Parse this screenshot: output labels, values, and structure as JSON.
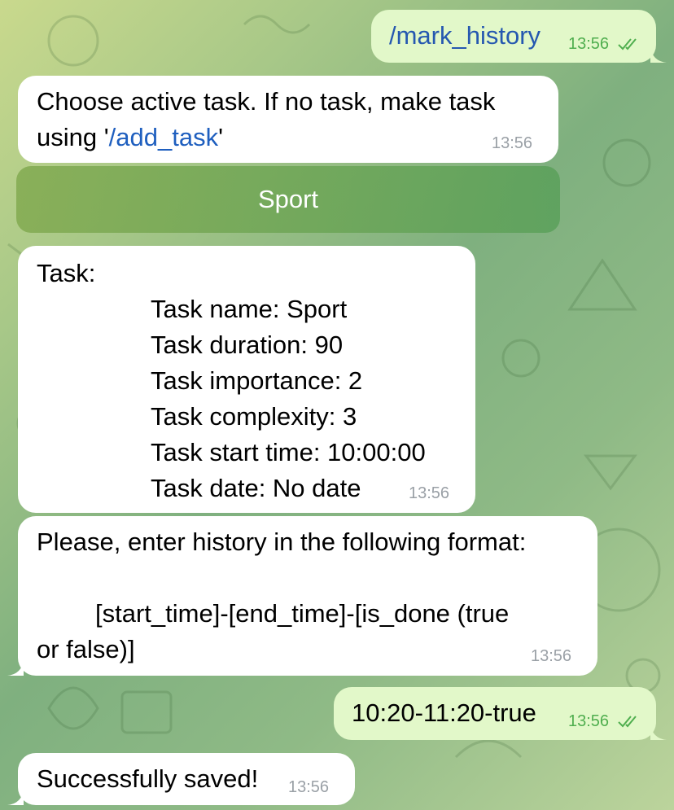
{
  "messages": {
    "cmd_mark_history": {
      "text": "/mark_history",
      "time": "13:56"
    },
    "choose_task": {
      "line1": "Choose active task. If no task, make task",
      "line2_pre": "using '",
      "line2_link": "/add_task",
      "line2_post": "'",
      "time": "13:56"
    },
    "keyboard": {
      "sport_button": "Sport"
    },
    "task_info": {
      "header": "Task:",
      "lines": [
        "Task name: Sport",
        "Task duration: 90",
        "Task importance: 2",
        "Task complexity: 3",
        "Task start time: 10:00:00",
        "Task date: No date"
      ],
      "time": "13:56"
    },
    "format_prompt": {
      "line1": "Please, enter history in the following format:",
      "line3": "[start_time]-[end_time]-[is_done (true",
      "line4": "or false)]",
      "time": "13:56"
    },
    "user_history": {
      "text": "10:20-11:20-true",
      "time": "13:56"
    },
    "saved": {
      "text": "Successfully saved!",
      "time": "13:56"
    }
  },
  "colors": {
    "outgoing_bubble": "#e2f8c9",
    "incoming_bubble": "#ffffff",
    "link": "#1f5fbf",
    "out_time": "#4fae4e"
  }
}
